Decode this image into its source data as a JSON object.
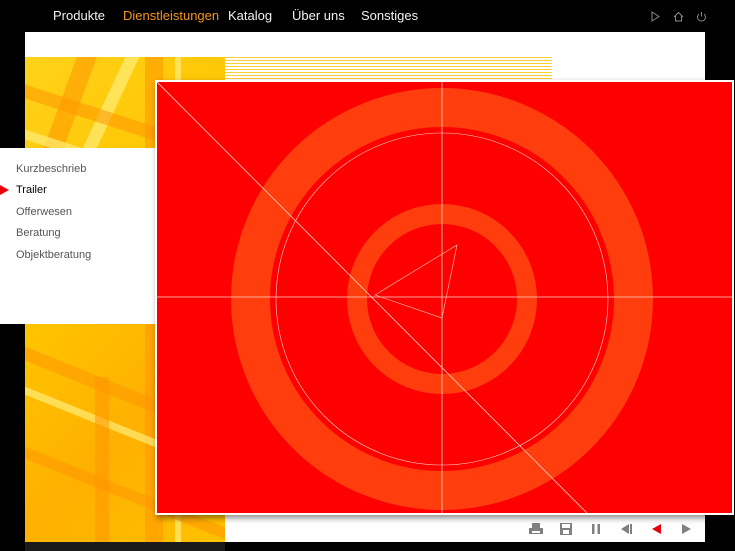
{
  "nav": {
    "items": [
      {
        "label": "Produkte"
      },
      {
        "label": "Dienstleistungen",
        "active": true
      },
      {
        "label": "Katalog"
      },
      {
        "label": "Über uns"
      },
      {
        "label": "Sonstiges"
      }
    ],
    "active_color": "#f7941d",
    "icons": [
      "play-small-icon",
      "home-icon",
      "power-icon"
    ]
  },
  "submenu": {
    "items": [
      {
        "label": "Kurzbeschrieb"
      },
      {
        "label": "Trailer",
        "active": true
      },
      {
        "label": "Offerwesen"
      },
      {
        "label": "Beratung"
      },
      {
        "label": "Objektberatung"
      }
    ],
    "marker_color": "#e8000b"
  },
  "video": {
    "background_color": "#ff0000",
    "ring_color": "#ff3d0d",
    "line_color": "#ffd6c8"
  },
  "controls": {
    "icons": [
      "print-icon",
      "save-icon",
      "pause-icon",
      "skip-back-icon",
      "rewind-icon",
      "play-icon"
    ],
    "active_icon": "rewind-icon",
    "active_color": "#e8000b",
    "icon_color": "#808080"
  }
}
